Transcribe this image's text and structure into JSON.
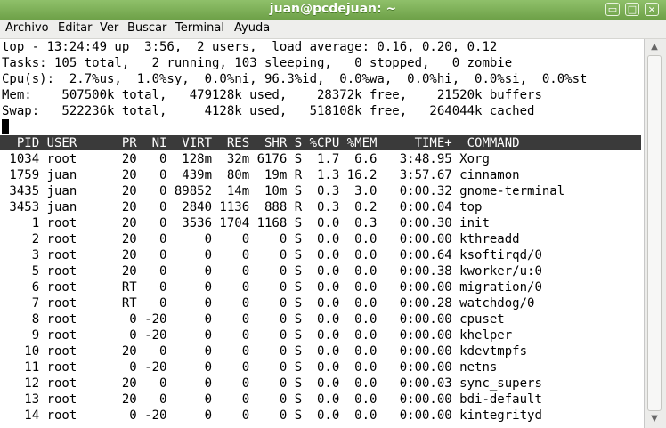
{
  "window": {
    "title": "juan@pcdejuan: ~",
    "controls": {
      "minimize": "▭",
      "maximize": "□",
      "close": "×"
    }
  },
  "menu": [
    "Archivo",
    "Editar",
    "Ver",
    "Buscar",
    "Terminal",
    "Ayuda"
  ],
  "top_output": {
    "summary": [
      "top - 13:24:49 up  3:56,  2 users,  load average: 0.16, 0.20, 0.12",
      "Tasks: 105 total,   2 running, 103 sleeping,   0 stopped,   0 zombie",
      "Cpu(s):  2.7%us,  1.0%sy,  0.0%ni, 96.3%id,  0.0%wa,  0.0%hi,  0.0%si,  0.0%st",
      "Mem:    507500k total,   479128k used,    28372k free,    21520k buffers",
      "Swap:   522236k total,     4128k used,   518108k free,   264044k cached"
    ],
    "header": "  PID USER      PR  NI  VIRT  RES  SHR S %CPU %MEM     TIME+  COMMAND",
    "rows": [
      " 1034 root      20   0  128m  32m 6176 S  1.7  6.6   3:48.95 Xorg",
      " 1759 juan      20   0  439m  80m  19m R  1.3 16.2   3:57.67 cinnamon",
      " 3435 juan      20   0 89852  14m  10m S  0.3  3.0   0:00.32 gnome-terminal",
      " 3453 juan      20   0  2840 1136  888 R  0.3  0.2   0:00.04 top",
      "    1 root      20   0  3536 1704 1168 S  0.0  0.3   0:00.30 init",
      "    2 root      20   0     0    0    0 S  0.0  0.0   0:00.00 kthreadd",
      "    3 root      20   0     0    0    0 S  0.0  0.0   0:00.64 ksoftirqd/0",
      "    5 root      20   0     0    0    0 S  0.0  0.0   0:00.38 kworker/u:0",
      "    6 root      RT   0     0    0    0 S  0.0  0.0   0:00.00 migration/0",
      "    7 root      RT   0     0    0    0 S  0.0  0.0   0:00.28 watchdog/0",
      "    8 root       0 -20     0    0    0 S  0.0  0.0   0:00.00 cpuset",
      "    9 root       0 -20     0    0    0 S  0.0  0.0   0:00.00 khelper",
      "   10 root      20   0     0    0    0 S  0.0  0.0   0:00.00 kdevtmpfs",
      "   11 root       0 -20     0    0    0 S  0.0  0.0   0:00.00 netns",
      "   12 root      20   0     0    0    0 S  0.0  0.0   0:00.03 sync_supers",
      "   13 root      20   0     0    0    0 S  0.0  0.0   0:00.00 bdi-default",
      "   14 root       0 -20     0    0    0 S  0.0  0.0   0:00.00 kintegrityd"
    ]
  },
  "scrollbar": {
    "up_arrow": "▲",
    "down_arrow": "▼"
  }
}
